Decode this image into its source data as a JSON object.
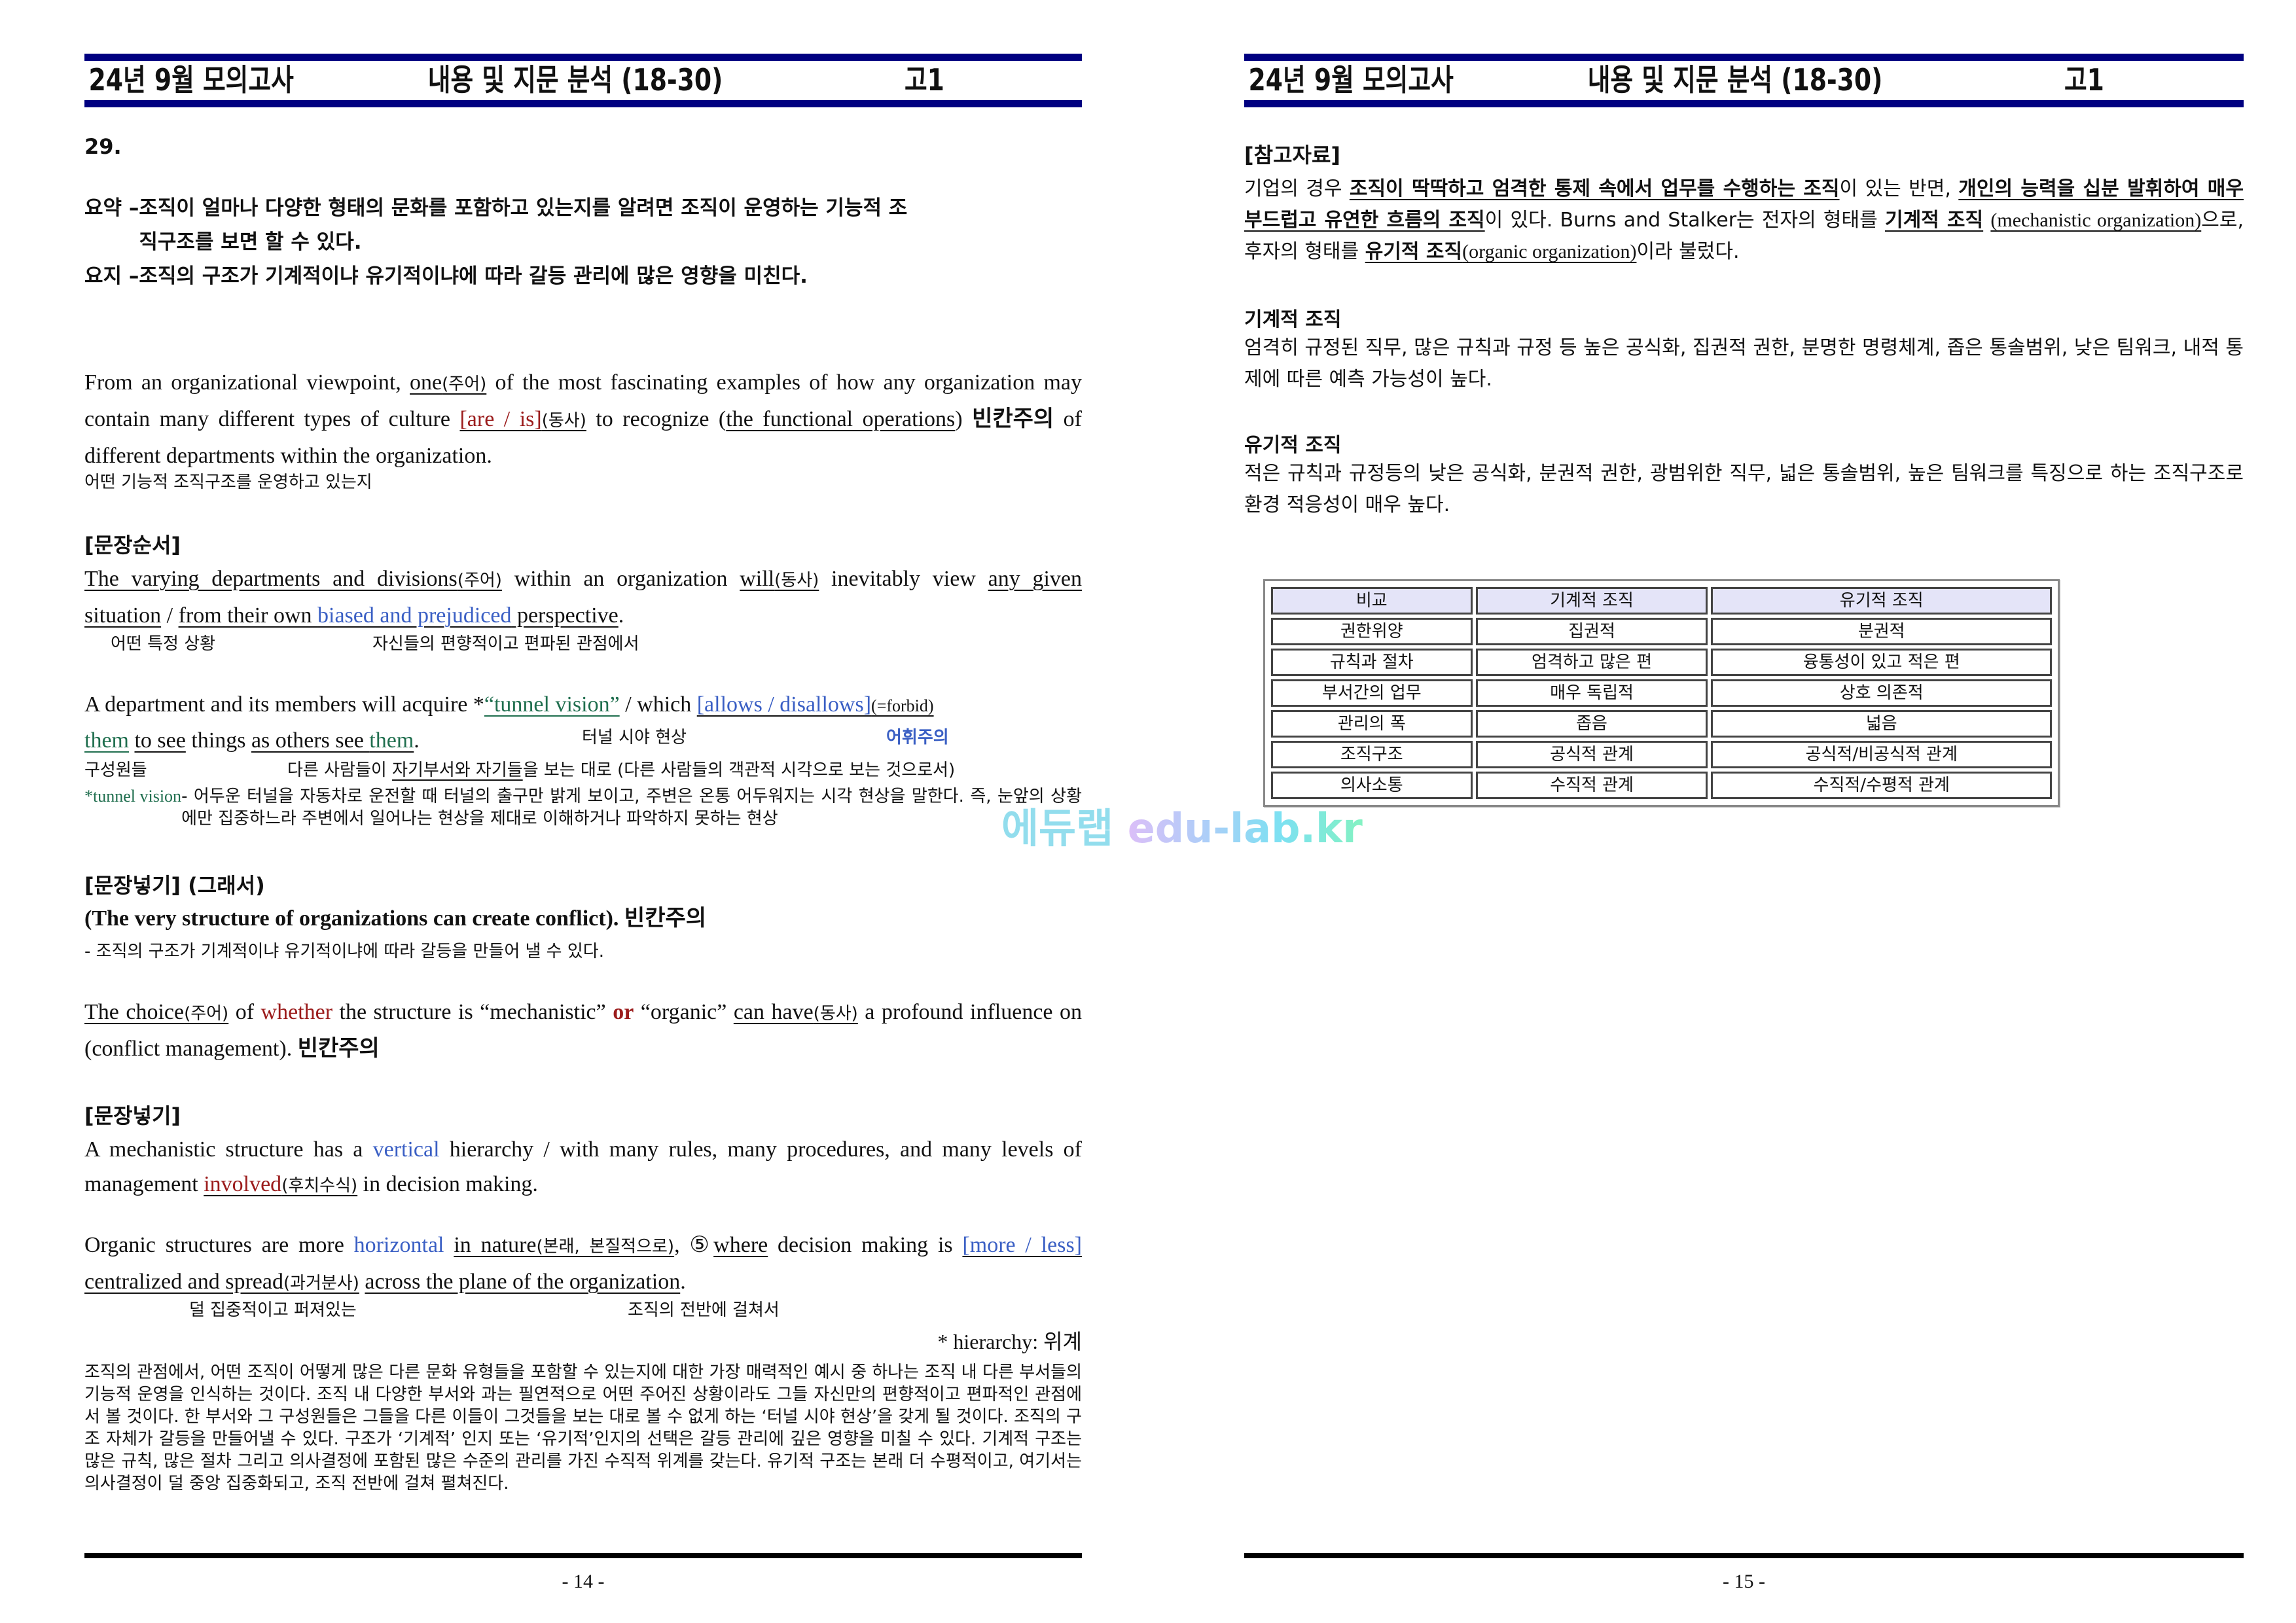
{
  "header": {
    "exam": "24년 9월 모의고사",
    "title": "내용 및 지문 분석 (18-30)",
    "grade": "고1"
  },
  "left_page": {
    "question_number": "29.",
    "summary": {
      "label1": "요약 – ",
      "text1a": "조직이 얼마나 다양한 형태의 문화를 포함하고 있는지를 알려면 조직이 운영하는 기능적 조",
      "text1b": "직구조를 보면 할 수 있다.",
      "label2": "요지 – ",
      "text2": "조직의 구조가 기계적이냐 유기적이냐에 따라 갈등 관리에 많은 영향을 미친다."
    },
    "p1": {
      "s1": "From an organizational viewpoint, ",
      "subj": "one",
      "subj_tag": "(주어)",
      "s2": " of the most fascinating examples of how any organization may contain many different types of culture ",
      "verb": "[are / is]",
      "verb_tag": "(동사)",
      "s3": " to recognize (",
      "obj": "the functional operations",
      "s4": ") ",
      "blank_note": "빈칸주의",
      "s5": " of different departments within the organization.",
      "gloss": "어떤 기능적 조직구조를 운영하고 있는지"
    },
    "order": {
      "title": "[문장순서]",
      "subj": "The varying departments and divisions",
      "subj_tag": "(주어)",
      "s1": " within an organization ",
      "verb": "will",
      "verb_tag": "(동사)",
      "s2": " inevitably view ",
      "ph1": "any given situation",
      "slash": " / ",
      "ph2a": "from their own ",
      "ph2_blue": "biased and prejudiced",
      "ph2b": " perspective",
      "end": ".",
      "gloss1": "어떤 특정 상황",
      "gloss2": "자신들의 편향적이고 편파된 관점에서"
    },
    "tunnel": {
      "s1": "A department and its members will acquire *",
      "tv": "“tunnel vision”",
      "s2": " / which ",
      "choice": "[allows / disallows]",
      "choice_tag": "(=forbid)",
      "them1": "them",
      "to_see": "to see",
      "things": " things ",
      "as_others": "as others see ",
      "them2": "them",
      "end": ".",
      "gloss_tv": "터널 시야 현상",
      "vocab_note": "어휘주의",
      "gloss_members": "구성원들",
      "gloss_as1": "다른 사람들이 ",
      "gloss_as_u": "자기부서와 자기들",
      "gloss_as2": "을 보는 대로 (다른 사람들의 객관적 시각으로 보는 것으로서)",
      "def_label": "*tunnel vision",
      "def_text": " - 어두운 터널을 자동차로 운전할 때 터널의 출구만 밝게 보이고, 주변은 온통 어두워지는 시각 현상을 말한다. 즉, 눈앞의 상황에만 집중하느라 주변에서 일어나는 현상을 제대로 이해하거나 파악하지 못하는 현상"
    },
    "insert1": {
      "title": "[문장넣기] (그래서)",
      "sentence": "(The very structure of organizations can create conflict).",
      "blank_note": "빈칸주의",
      "gloss": "- 조직의 구조가 기계적이냐 유기적이냐에 따라 갈등을 만들어 낼 수 있다."
    },
    "choice_para": {
      "subj": "The choice",
      "subj_tag": "(주어)",
      "s1": " of ",
      "whether": "whether",
      "s2": " the structure is “mechanistic” ",
      "or": "or",
      "s3": " “organic” ",
      "verb": "can have",
      "verb_tag": "(동사)",
      "s4": " a profound influence on (conflict management).",
      "blank_note": "빈칸주의"
    },
    "insert2": {
      "title": "[문장넣기]",
      "m1": "A mechanistic structure has a ",
      "vertical": "vertical",
      "m2": " hierarchy / with many rules, many procedures, and many levels of management ",
      "involved": "involved",
      "involved_tag": "(후치수식)",
      "m3": " in decision making.",
      "o1": "Organic structures are more ",
      "horizontal": "horizontal",
      "o2": " ",
      "in_nature": "in nature",
      "in_nature_tag": "(본래, 본질적으로)",
      "o3": ", ⑤",
      "where": "where",
      "o4": " decision making is ",
      "more_less": "[more / less]",
      "o5": " centralized and spread",
      "spread_tag": "(과거분사)",
      "o6": " ",
      "across": "across the plane of the organization",
      "end": ".",
      "gloss1": "덜 집중적이고 퍼져있는",
      "gloss2": "조직의 전반에 걸쳐서",
      "vocab": "* hierarchy: 위계"
    },
    "translation": "조직의 관점에서, 어떤 조직이 어떻게 많은 다른 문화 유형들을 포함할 수 있는지에 대한 가장 매력적인 예시 중 하나는 조직 내 다른 부서들의 기능적 운영을 인식하는 것이다. 조직 내 다양한 부서와 과는 필연적으로 어떤 주어진 상황이라도 그들 자신만의 편향적이고 편파적인 관점에서 볼 것이다. 한 부서와 그 구성원들은 그들을 다른 이들이 그것들을 보는 대로 볼 수 없게 하는 ‘터널 시야 현상’을 갖게 될 것이다. 조직의 구조 자체가 갈등을 만들어낼 수 있다. 구조가 ‘기계적’ 인지 또는 ‘유기적’인지의 선택은 갈등 관리에 깊은 영향을 미칠 수 있다. 기계적 구조는 많은 규칙, 많은 절차 그리고 의사결정에 포함된 많은 수준의 관리를 가진 수직적 위계를 갖는다. 유기적 구조는 본래 더 수평적이고, 여기서는 의사결정이 덜 중앙 집중화되고, 조직 전반에 걸쳐 펼쳐진다.",
    "page_number": "- 14 -"
  },
  "right_page": {
    "ref_title": "[참고자료]",
    "ref": {
      "r1": "기업의 경우 ",
      "b1": "조직이 딱딱하고 엄격한 통제 속에서 업무를 수행하는 조직",
      "r2": "이 있는 반면, ",
      "b2": "개인의 능력을 십분 발휘하여 매우 부드럽고 유연한 흐름의 조직",
      "r3": "이 있다. Burns and Stalker는 전자의 형태를 ",
      "b3": "기계적 조직",
      "r4": " ",
      "u4": "(mechanistic organization)",
      "r5": "으로, 후자의 형태를 ",
      "b5": "유기적 조직",
      "u5": "(organic organization)",
      "r6": "이라 불렀다."
    },
    "mech_title": "기계적 조직",
    "mech_text": "엄격히 규정된 직무, 많은 규칙과 규정 등 높은 공식화, 집권적 권한, 분명한 명령체계, 좁은 통솔범위, 낮은 팀워크, 내적 통제에 따른 예측 가능성이 높다.",
    "org_title": "유기적 조직",
    "org_text": "적은 규칙과 규정등의 낮은 공식화, 분권적 권한, 광범위한 직무, 넓은 통솔범위, 높은 팀워크를 특징으로 하는 조직구조로 환경 적응성이 매우 높다.",
    "table": {
      "headers": [
        "비교",
        "기계적 조직",
        "유기적 조직"
      ],
      "rows": [
        [
          "권한위양",
          "집권적",
          "분권적"
        ],
        [
          "규칙과 절차",
          "엄격하고 많은 편",
          "융통성이 있고 적은 편"
        ],
        [
          "부서간의 업무",
          "매우 독립적",
          "상호 의존적"
        ],
        [
          "관리의 폭",
          "좁음",
          "넓음"
        ],
        [
          "조직구조",
          "공식적 관계",
          "공식적/비공식적 관계"
        ],
        [
          "의사소통",
          "수직적 관계",
          "수직적/수평적 관계"
        ]
      ]
    },
    "page_number": "- 15 -"
  },
  "watermark": {
    "ko": "에듀랩",
    "en": "edu-lab.kr"
  },
  "colors": {
    "header_bar": "#000080",
    "emphasis_red": "#9b1c1c",
    "emphasis_blue": "#3a5fc4",
    "emphasis_green": "#1f6e4e",
    "table_header_bg": "#e4e4f8"
  }
}
